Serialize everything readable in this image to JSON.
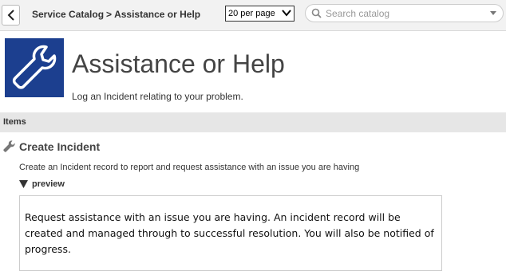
{
  "topbar": {
    "breadcrumb": [
      "Service Catalog",
      "Assistance or Help"
    ],
    "breadcrumb_separator": ">",
    "per_page": "20 per page",
    "search_placeholder": "Search catalog"
  },
  "header": {
    "title": "Assistance or Help",
    "subtitle": "Log an Incident relating to your problem.",
    "logo_icon": "wrench-icon",
    "logo_color": "#1c3f8f"
  },
  "section": {
    "label": "Items"
  },
  "item": {
    "title": "Create Incident",
    "description": "Create an Incident record to report and request assistance with an issue you are having",
    "preview_label": "preview",
    "preview_text": "Request assistance with an issue you are having. An incident record will be created and managed through to successful resolution. You will also be notified of progress."
  }
}
